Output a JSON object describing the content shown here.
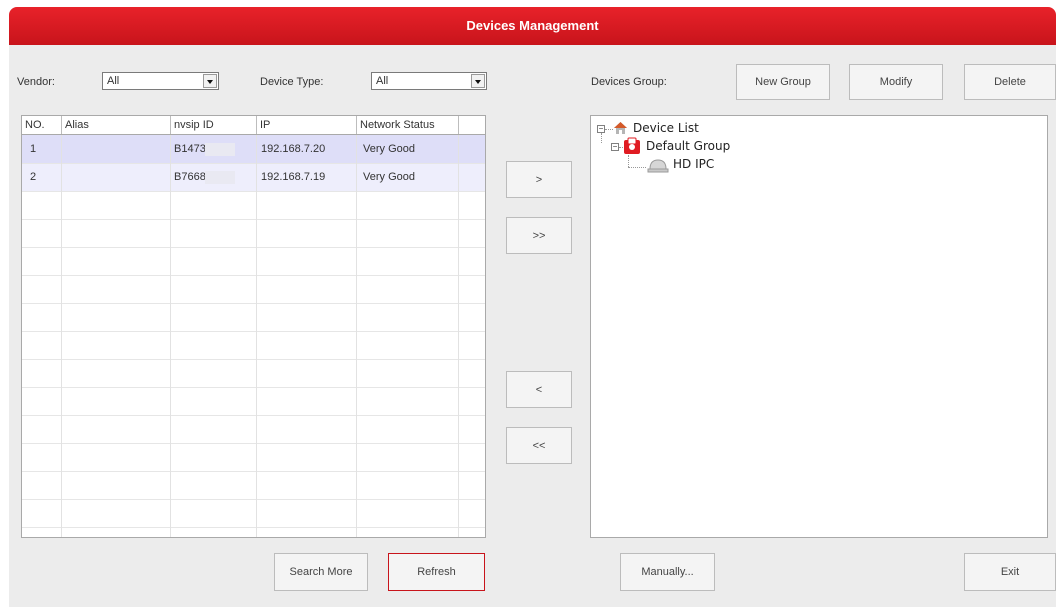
{
  "window": {
    "title": "Devices Management"
  },
  "filters": {
    "vendor_label": "Vendor:",
    "vendor_value": "All",
    "device_type_label": "Device Type:",
    "device_type_value": "All"
  },
  "table": {
    "columns": [
      "NO.",
      "Alias",
      "nvsip ID",
      "IP",
      "Network Status"
    ],
    "rows": [
      {
        "no": "1",
        "alias": "",
        "nvsip_id": "B1473",
        "ip": "192.168.7.20",
        "status": "Very Good"
      },
      {
        "no": "2",
        "alias": "",
        "nvsip_id": "B7668",
        "ip": "192.168.7.19",
        "status": "Very Good"
      }
    ]
  },
  "transfer_buttons": {
    "add_one": ">",
    "add_all": ">>",
    "remove_one": "<",
    "remove_all": "<<"
  },
  "group": {
    "label": "Devices Group:",
    "new_group": "New Group",
    "modify": "Modify",
    "delete": "Delete"
  },
  "tree": {
    "root": {
      "label": "Device List",
      "icon": "home-icon"
    },
    "group": {
      "label": "Default Group",
      "icon": "group-icon"
    },
    "device": {
      "label": "HD IPC",
      "icon": "camera-icon"
    }
  },
  "footer": {
    "search_more": "Search More",
    "refresh": "Refresh",
    "manually": "Manually...",
    "exit": "Exit"
  },
  "colors": {
    "title_bar": "#d7191f",
    "panel_bg": "#ececec",
    "row_highlight": "#eeeefc"
  }
}
